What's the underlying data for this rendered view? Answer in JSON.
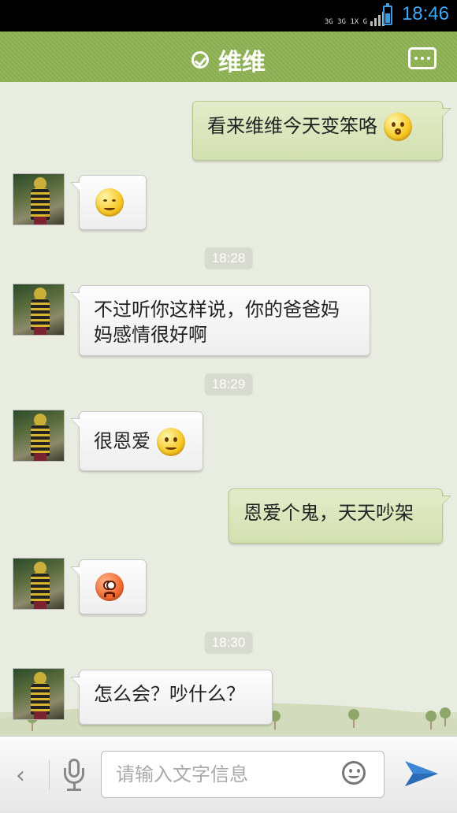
{
  "status_bar": {
    "network": "3G 3G 1X G",
    "time": "18:46",
    "battery_level": 0.55
  },
  "header": {
    "title": "维维",
    "online_status_icon": "check-circle-icon",
    "menu_icon": "more-icon"
  },
  "messages": [
    {
      "side": "right",
      "text": "看来维维今天变笨咯",
      "emoji": "shy"
    },
    {
      "side": "left",
      "text": "",
      "emoji": "smug"
    },
    {
      "type": "time",
      "text": "18:28"
    },
    {
      "side": "left",
      "text": "不过听你这样说，你的爸爸妈妈感情很好啊"
    },
    {
      "type": "time",
      "text": "18:29"
    },
    {
      "side": "left",
      "text": "很恩爱",
      "emoji": "smile"
    },
    {
      "side": "right",
      "text": "恩爱个鬼，天天吵架"
    },
    {
      "side": "left",
      "text": "",
      "emoji": "angry"
    },
    {
      "type": "time",
      "text": "18:30"
    },
    {
      "side": "left",
      "text": "怎么会？吵什么？"
    }
  ],
  "input_bar": {
    "placeholder": "请输入文字信息",
    "back_icon": "chevron-left-icon",
    "voice_icon": "microphone-icon",
    "emoji_icon": "smiley-icon",
    "send_icon": "send-icon"
  },
  "colors": {
    "header_green": "#8db253",
    "right_bubble": "#dce7be",
    "chat_background": "#e9ece0",
    "clock_blue": "#3fa9f5"
  }
}
